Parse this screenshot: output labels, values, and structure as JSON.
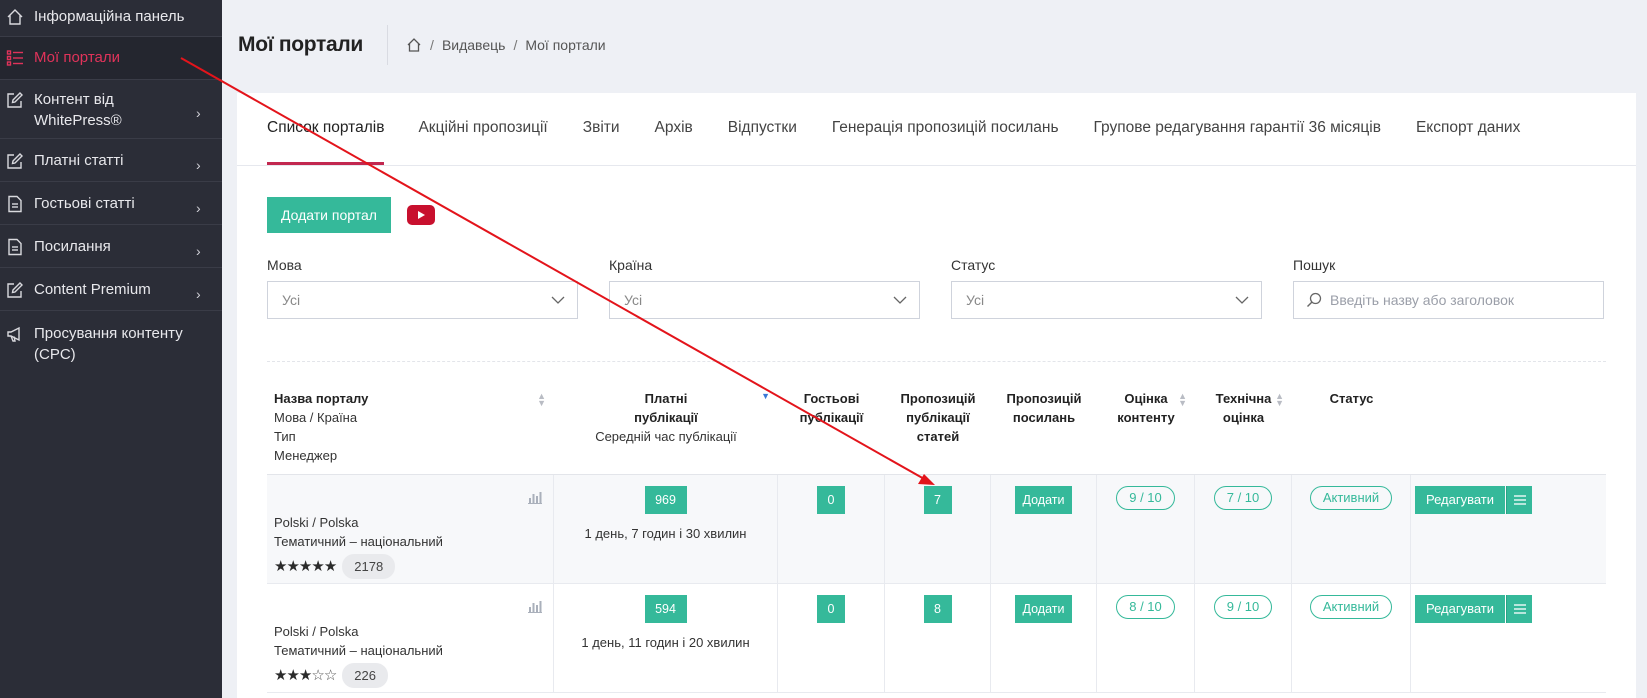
{
  "sidebar": {
    "items": [
      {
        "label": "Інформаційна панель",
        "icon": "home-icon",
        "has_chevron": false,
        "active": false
      },
      {
        "label": "Мої портали",
        "icon": "list-icon",
        "has_chevron": false,
        "active": true
      },
      {
        "label": "Контент від WhitePress®",
        "icon": "edit-icon",
        "has_chevron": true,
        "active": false
      },
      {
        "label": "Платні статті",
        "icon": "edit-icon",
        "has_chevron": true,
        "active": false
      },
      {
        "label": "Гостьові статті",
        "icon": "document-icon",
        "has_chevron": true,
        "active": false
      },
      {
        "label": "Посилання",
        "icon": "document-icon",
        "has_chevron": true,
        "active": false
      },
      {
        "label": "Content Premium",
        "icon": "edit-icon",
        "has_chevron": true,
        "active": false
      },
      {
        "label": "Просування контенту (CPC)",
        "icon": "megaphone-icon",
        "has_chevron": false,
        "active": false
      }
    ]
  },
  "header": {
    "title": "Мої портали",
    "breadcrumb": [
      "Видавець",
      "Мої портали"
    ]
  },
  "tabs": [
    {
      "label": "Список порталів",
      "active": true
    },
    {
      "label": "Акційні пропозиції",
      "active": false
    },
    {
      "label": "Звіти",
      "active": false
    },
    {
      "label": "Архів",
      "active": false
    },
    {
      "label": "Відпустки",
      "active": false
    },
    {
      "label": "Генерація пропозицій посилань",
      "active": false
    },
    {
      "label": "Групове редагування гарантії 36 місяців",
      "active": false
    },
    {
      "label": "Експорт даних",
      "active": false
    }
  ],
  "toolbar": {
    "add_label": "Додати портал"
  },
  "filters": {
    "language": {
      "label": "Мова",
      "value": "Усі"
    },
    "country": {
      "label": "Країна",
      "value": "Усі"
    },
    "status": {
      "label": "Статус",
      "value": "Усі"
    },
    "search": {
      "label": "Пошук",
      "placeholder": "Введіть назву або заголовок"
    }
  },
  "table": {
    "headers": {
      "name": [
        "Назва порталу",
        "Мова / Країна",
        "Тип",
        "Менеджер"
      ],
      "paid": [
        "Платні",
        "публікації",
        "Середній час публікації"
      ],
      "guest": [
        "Гостьові",
        "публікації"
      ],
      "article_offers": [
        "Пропозицій",
        "публікації",
        "статей"
      ],
      "link_offers": [
        "Пропозицій",
        "посилань"
      ],
      "content_rating": [
        "Оцінка",
        "контенту"
      ],
      "tech_rating": [
        "Технічна",
        "оцінка"
      ],
      "status": [
        "Статус"
      ]
    },
    "rows": [
      {
        "lang_country": "Polski / Polska",
        "type": "Тематичний – національний",
        "stars": 5,
        "count": "2178",
        "paid": "969",
        "avg_time": "1 день, 7 годин і 30 хвилин",
        "guest": "0",
        "article_offers": "7",
        "link_action": "Додати",
        "content_rating": "9 / 10",
        "tech_rating": "7 / 10",
        "status": "Активний",
        "edit_label": "Редагувати"
      },
      {
        "lang_country": "Polski / Polska",
        "type": "Тематичний – національний",
        "stars": 3,
        "count": "226",
        "paid": "594",
        "avg_time": "1 день, 11 годин і 20 хвилин",
        "guest": "0",
        "article_offers": "8",
        "link_action": "Додати",
        "content_rating": "8 / 10",
        "tech_rating": "9 / 10",
        "status": "Активний",
        "edit_label": "Редагувати"
      }
    ]
  },
  "colors": {
    "accent_green": "#35b99a",
    "active_red": "#e0335a",
    "sidebar_bg": "#2b2d37",
    "annotation_arrow": "#e3141b"
  }
}
